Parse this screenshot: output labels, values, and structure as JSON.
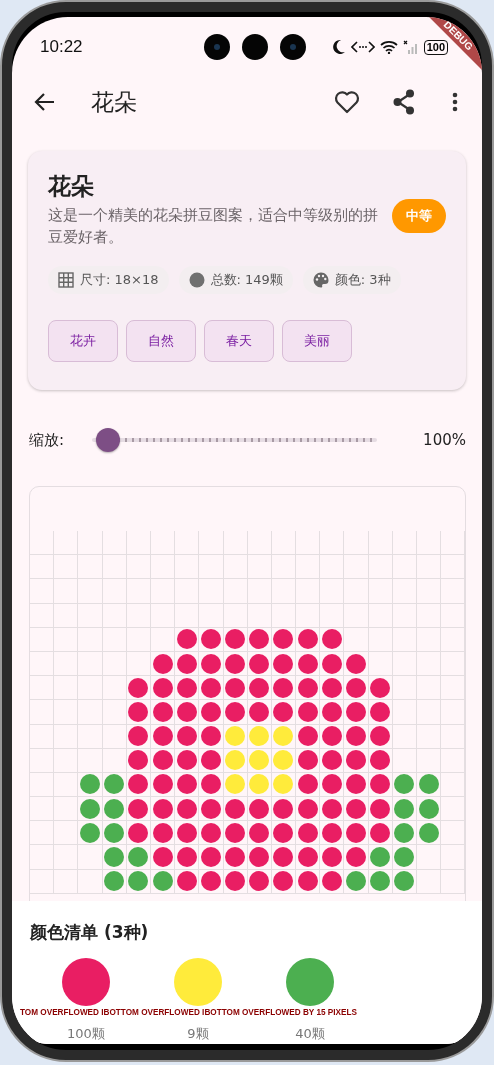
{
  "status_bar": {
    "time": "10:22",
    "battery": "100"
  },
  "debug_banner": "DEBUG",
  "app_bar": {
    "title": "花朵"
  },
  "card": {
    "title": "花朵",
    "description": "这是一个精美的花朵拼豆图案，适合中等级别的拼豆爱好者。",
    "difficulty": "中等",
    "stats": [
      {
        "kind": "size",
        "text": "尺寸: 18×18"
      },
      {
        "kind": "count",
        "text": "总数: 149颗"
      },
      {
        "kind": "colors",
        "text": "颜色: 3种"
      }
    ],
    "tags": [
      "花卉",
      "自然",
      "春天",
      "美丽"
    ]
  },
  "zoom": {
    "label": "缩放:",
    "level": 0,
    "reading": "100%"
  },
  "grid": {
    "rows": [
      [
        null,
        null,
        null,
        null,
        null,
        null,
        null,
        null,
        null,
        null,
        null,
        null,
        null,
        null,
        null,
        null,
        null,
        null
      ],
      [
        null,
        null,
        null,
        null,
        null,
        null,
        null,
        null,
        null,
        null,
        null,
        null,
        null,
        null,
        null,
        null,
        null,
        null
      ],
      [
        null,
        null,
        null,
        null,
        null,
        null,
        null,
        null,
        null,
        null,
        null,
        null,
        null,
        null,
        null,
        null,
        null,
        null
      ],
      [
        null,
        null,
        null,
        null,
        null,
        null,
        null,
        null,
        null,
        null,
        null,
        null,
        null,
        null,
        null,
        null,
        null,
        null
      ],
      [
        null,
        null,
        null,
        null,
        null,
        null,
        {
          "color": "#e91e63"
        },
        {
          "color": "#e91e63"
        },
        {
          "color": "#e91e63"
        },
        {
          "color": "#e91e63"
        },
        {
          "color": "#e91e63"
        },
        {
          "color": "#e91e63"
        },
        {
          "color": "#e91e63"
        },
        null,
        null,
        null,
        null,
        null
      ],
      [
        null,
        null,
        null,
        null,
        null,
        {
          "color": "#e91e63"
        },
        {
          "color": "#e91e63"
        },
        {
          "color": "#e91e63"
        },
        {
          "color": "#e91e63"
        },
        {
          "color": "#e91e63"
        },
        {
          "color": "#e91e63"
        },
        {
          "color": "#e91e63"
        },
        {
          "color": "#e91e63"
        },
        {
          "color": "#e91e63"
        },
        null,
        null,
        null,
        null
      ],
      [
        null,
        null,
        null,
        null,
        {
          "color": "#e91e63"
        },
        {
          "color": "#e91e63"
        },
        {
          "color": "#e91e63"
        },
        {
          "color": "#e91e63"
        },
        {
          "color": "#e91e63"
        },
        {
          "color": "#e91e63"
        },
        {
          "color": "#e91e63"
        },
        {
          "color": "#e91e63"
        },
        {
          "color": "#e91e63"
        },
        {
          "color": "#e91e63"
        },
        {
          "color": "#e91e63"
        },
        null,
        null,
        null
      ],
      [
        null,
        null,
        null,
        null,
        {
          "color": "#e91e63"
        },
        {
          "color": "#e91e63"
        },
        {
          "color": "#e91e63"
        },
        {
          "color": "#e91e63"
        },
        {
          "color": "#e91e63"
        },
        {
          "color": "#e91e63"
        },
        {
          "color": "#e91e63"
        },
        {
          "color": "#e91e63"
        },
        {
          "color": "#e91e63"
        },
        {
          "color": "#e91e63"
        },
        {
          "color": "#e91e63"
        },
        null,
        null,
        null
      ],
      [
        null,
        null,
        null,
        null,
        {
          "color": "#e91e63"
        },
        {
          "color": "#e91e63"
        },
        {
          "color": "#e91e63"
        },
        {
          "color": "#e91e63"
        },
        {
          "color": "#ffeb3b"
        },
        {
          "color": "#ffeb3b"
        },
        {
          "color": "#ffeb3b"
        },
        {
          "color": "#e91e63"
        },
        {
          "color": "#e91e63"
        },
        {
          "color": "#e91e63"
        },
        {
          "color": "#e91e63"
        },
        null,
        null,
        null
      ],
      [
        null,
        null,
        null,
        null,
        {
          "color": "#e91e63"
        },
        {
          "color": "#e91e63"
        },
        {
          "color": "#e91e63"
        },
        {
          "color": "#e91e63"
        },
        {
          "color": "#ffeb3b"
        },
        {
          "color": "#ffeb3b"
        },
        {
          "color": "#ffeb3b"
        },
        {
          "color": "#e91e63"
        },
        {
          "color": "#e91e63"
        },
        {
          "color": "#e91e63"
        },
        {
          "color": "#e91e63"
        },
        null,
        null,
        null
      ],
      [
        null,
        null,
        {
          "color": "#4caf50"
        },
        {
          "color": "#4caf50"
        },
        {
          "color": "#e91e63"
        },
        {
          "color": "#e91e63"
        },
        {
          "color": "#e91e63"
        },
        {
          "color": "#e91e63"
        },
        {
          "color": "#ffeb3b"
        },
        {
          "color": "#ffeb3b"
        },
        {
          "color": "#ffeb3b"
        },
        {
          "color": "#e91e63"
        },
        {
          "color": "#e91e63"
        },
        {
          "color": "#e91e63"
        },
        {
          "color": "#e91e63"
        },
        {
          "color": "#4caf50"
        },
        {
          "color": "#4caf50"
        },
        null
      ],
      [
        null,
        null,
        {
          "color": "#4caf50"
        },
        {
          "color": "#4caf50"
        },
        {
          "color": "#e91e63"
        },
        {
          "color": "#e91e63"
        },
        {
          "color": "#e91e63"
        },
        {
          "color": "#e91e63"
        },
        {
          "color": "#e91e63"
        },
        {
          "color": "#e91e63"
        },
        {
          "color": "#e91e63"
        },
        {
          "color": "#e91e63"
        },
        {
          "color": "#e91e63"
        },
        {
          "color": "#e91e63"
        },
        {
          "color": "#e91e63"
        },
        {
          "color": "#4caf50"
        },
        {
          "color": "#4caf50"
        },
        null
      ],
      [
        null,
        null,
        {
          "color": "#4caf50"
        },
        {
          "color": "#4caf50"
        },
        {
          "color": "#e91e63"
        },
        {
          "color": "#e91e63"
        },
        {
          "color": "#e91e63"
        },
        {
          "color": "#e91e63"
        },
        {
          "color": "#e91e63"
        },
        {
          "color": "#e91e63"
        },
        {
          "color": "#e91e63"
        },
        {
          "color": "#e91e63"
        },
        {
          "color": "#e91e63"
        },
        {
          "color": "#e91e63"
        },
        {
          "color": "#e91e63"
        },
        {
          "color": "#4caf50"
        },
        {
          "color": "#4caf50"
        },
        null
      ],
      [
        null,
        null,
        null,
        {
          "color": "#4caf50"
        },
        {
          "color": "#4caf50"
        },
        {
          "color": "#e91e63"
        },
        {
          "color": "#e91e63"
        },
        {
          "color": "#e91e63"
        },
        {
          "color": "#e91e63"
        },
        {
          "color": "#e91e63"
        },
        {
          "color": "#e91e63"
        },
        {
          "color": "#e91e63"
        },
        {
          "color": "#e91e63"
        },
        {
          "color": "#e91e63"
        },
        {
          "color": "#4caf50"
        },
        {
          "color": "#4caf50"
        },
        null,
        null
      ],
      [
        null,
        null,
        null,
        {
          "color": "#4caf50"
        },
        {
          "color": "#4caf50"
        },
        {
          "color": "#4caf50"
        },
        {
          "color": "#e91e63"
        },
        {
          "color": "#e91e63"
        },
        {
          "color": "#e91e63"
        },
        {
          "color": "#e91e63"
        },
        {
          "color": "#e91e63"
        },
        {
          "color": "#e91e63"
        },
        {
          "color": "#e91e63"
        },
        {
          "color": "#4caf50"
        },
        {
          "color": "#4caf50"
        },
        {
          "color": "#4caf50"
        },
        null,
        null
      ]
    ]
  },
  "color_list": {
    "title": "颜色清单 (3种)",
    "items": [
      {
        "color": "#e91e63",
        "count": "100颗"
      },
      {
        "color": "#ffeb3b",
        "count": "9颗"
      },
      {
        "color": "#4caf50",
        "count": "40颗"
      }
    ]
  },
  "overflow_warnings": [
    "TOM OVERFLOWED I",
    "BOTTOM OVERFLOWED I",
    "BOTTOM OVERFLOWED BY 15 PIXELS"
  ]
}
